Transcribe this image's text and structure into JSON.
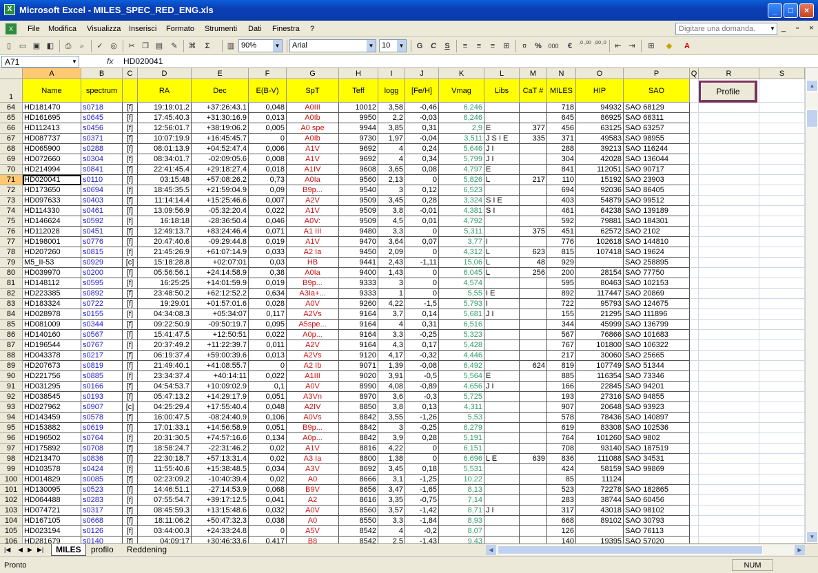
{
  "window": {
    "title": "Microsoft Excel - MILES_SPEC_RED_ENG.xls",
    "app_icon": "excel-icon"
  },
  "menu": {
    "items": [
      "File",
      "Modifica",
      "Visualizza",
      "Inserisci",
      "Formato",
      "Strumenti",
      "Dati",
      "Finestra",
      "?"
    ],
    "ask_placeholder": "Digitare una domanda."
  },
  "toolbar": {
    "zoom": "90%",
    "font": "Arial",
    "size": "10",
    "bold": "G",
    "italic": "C",
    "underline": "S",
    "sum": "Σ",
    "percent": "%",
    "thousands": "000",
    "euro": "€",
    "dec_inc": ",0 ,00",
    "dec_dec": ",00 ,0"
  },
  "formula": {
    "name_box": "A71",
    "fx": "fx",
    "content": "HD020041"
  },
  "columns": [
    "A",
    "B",
    "C",
    "D",
    "E",
    "F",
    "G",
    "H",
    "I",
    "J",
    "K",
    "L",
    "M",
    "N",
    "O",
    "P",
    "Q",
    "R",
    "S"
  ],
  "header_row_number": "1",
  "headers": [
    "Name",
    "spectrum",
    "",
    "RA",
    "Dec",
    "E(B-V)",
    "SpT",
    "Teff",
    "logg",
    "[Fe/H]",
    "Vmag",
    "Libs",
    "CaT #",
    "MILES",
    "HIP",
    "SAO"
  ],
  "profile_button": "Profile",
  "rows": [
    [
      "64",
      "HD181470",
      "s0718",
      "[f]",
      "19:19:01.2",
      "+37:26:43.1",
      "0,048",
      "A0III",
      "10012",
      "3,58",
      "-0,46",
      "6,246",
      "",
      "",
      "718",
      "94932",
      "SAO 68129"
    ],
    [
      "65",
      "HD161695",
      "s0645",
      "[f]",
      "17:45:40.3",
      "+31:30:16.9",
      "0,013",
      "A0Ib",
      "9950",
      "2,2",
      "-0,03",
      "6,246",
      "",
      "",
      "645",
      "86925",
      "SAO 66311"
    ],
    [
      "66",
      "HD112413",
      "s0456",
      "[f]",
      "12:56:01.7",
      "+38:19:06.2",
      "0,005",
      "A0 spe",
      "9944",
      "3,85",
      "0,31",
      "2,9",
      "E",
      "377",
      "456",
      "63125",
      "SAO 63257"
    ],
    [
      "67",
      "HD087737",
      "s0371",
      "[f]",
      "10:07:19.9",
      "+16:45:45.7",
      "0",
      "A0Ib",
      "9730",
      "1,97",
      "-0,04",
      "3,511",
      "J S I E",
      "335",
      "371",
      "49583",
      "SAO 98955"
    ],
    [
      "68",
      "HD065900",
      "s0288",
      "[f]",
      "08:01:13.9",
      "+04:52:47.4",
      "0,006",
      "A1V",
      "9692",
      "4",
      "0,24",
      "5,646",
      "J I",
      "",
      "288",
      "39213",
      "SAO 116244"
    ],
    [
      "69",
      "HD072660",
      "s0304",
      "[f]",
      "08:34:01.7",
      "-02:09:05.6",
      "0,008",
      "A1V",
      "9692",
      "4",
      "0,34",
      "5,799",
      "J I",
      "",
      "304",
      "42028",
      "SAO 136044"
    ],
    [
      "70",
      "HD214994",
      "s0841",
      "[f]",
      "22:41:45.4",
      "+29:18:27.4",
      "0,018",
      "A1IV",
      "9608",
      "3,65",
      "0,08",
      "4,797",
      "E",
      "",
      "841",
      "112051",
      "SAO 90717"
    ],
    [
      "71",
      "HD020041",
      "s0110",
      "[f]",
      "03:15:48",
      "+57:08:26.2",
      "0,73",
      "A0Ia",
      "9560",
      "2,13",
      "0",
      "5,826",
      "L",
      "217",
      "110",
      "15192",
      "SAO 23903"
    ],
    [
      "72",
      "HD173650",
      "s0694",
      "[f]",
      "18:45:35.5",
      "+21:59:04.9",
      "0,09",
      "B9p...",
      "9540",
      "3",
      "0,12",
      "6,523",
      "",
      "",
      "694",
      "92036",
      "SAO 86405"
    ],
    [
      "73",
      "HD097633",
      "s0403",
      "[f]",
      "11:14:14.4",
      "+15:25:46.6",
      "0,007",
      "A2V",
      "9509",
      "3,45",
      "0,28",
      "3,324",
      "S I E",
      "",
      "403",
      "54879",
      "SAO 99512"
    ],
    [
      "74",
      "HD114330",
      "s0461",
      "[f]",
      "13:09:56.9",
      "-05:32:20.4",
      "0,022",
      "A1V",
      "9509",
      "3,8",
      "-0,01",
      "4,381",
      "S I",
      "",
      "461",
      "64238",
      "SAO 139189"
    ],
    [
      "75",
      "HD146624",
      "s0592",
      "[f]",
      "16:18:18",
      "-28:36:50.4",
      "0,046",
      "A0V:",
      "9509",
      "4,5",
      "0,01",
      "4,792",
      "",
      "",
      "592",
      "79881",
      "SAO 184301"
    ],
    [
      "76",
      "HD112028",
      "s0451",
      "[f]",
      "12:49:13.7",
      "+83:24:46.4",
      "0,071",
      "A1 III",
      "9480",
      "3,3",
      "0",
      "5,311",
      "",
      "375",
      "451",
      "62572",
      "SAO 2102"
    ],
    [
      "77",
      "HD198001",
      "s0776",
      "[f]",
      "20:47:40.6",
      "-09:29:44.8",
      "0,019",
      "A1V",
      "9470",
      "3,64",
      "0,07",
      "3,77",
      "I",
      "",
      "776",
      "102618",
      "SAO 144810"
    ],
    [
      "78",
      "HD207260",
      "s0815",
      "[f]",
      "21:45:26.9",
      "+61:07:14.9",
      "0,033",
      "A2 Ia",
      "9450",
      "2,09",
      "0",
      "4,312",
      "L",
      "623",
      "815",
      "107418",
      "SAO 19624"
    ],
    [
      "79",
      "M5_II-53",
      "s0929",
      "[c]",
      "15:18:28.8",
      "+02:07:01",
      "0,03",
      "HB",
      "9441",
      "2,43",
      "-1,11",
      "15,06",
      "L",
      "48",
      "929",
      "",
      "SAO 258895"
    ],
    [
      "80",
      "HD039970",
      "s0200",
      "[f]",
      "05:56:56.1",
      "+24:14:58.9",
      "0,38",
      "A0Ia",
      "9400",
      "1,43",
      "0",
      "6,045",
      "L",
      "256",
      "200",
      "28154",
      "SAO 77750"
    ],
    [
      "81",
      "HD148112",
      "s0595",
      "[f]",
      "16:25:25",
      "+14:01:59.9",
      "0,019",
      "B9p...",
      "9333",
      "3",
      "0",
      "4,574",
      "",
      "",
      "595",
      "80463",
      "SAO 102153"
    ],
    [
      "82",
      "HD223385",
      "s0892",
      "[f]",
      "23:48:50.2",
      "+62:12:52.2",
      "0,634",
      "A3Ia+...",
      "9333",
      "1",
      "0",
      "5,55",
      "I E",
      "",
      "892",
      "117447",
      "SAO 20869"
    ],
    [
      "83",
      "HD183324",
      "s0722",
      "[f]",
      "19:29:01",
      "+01:57:01.6",
      "0,028",
      "A0V",
      "9260",
      "4,22",
      "-1,5",
      "5,793",
      "I",
      "",
      "722",
      "95793",
      "SAO 124675"
    ],
    [
      "84",
      "HD028978",
      "s0155",
      "[f]",
      "04:34:08.3",
      "+05:34:07",
      "0,117",
      "A2Vs",
      "9164",
      "3,7",
      "0,14",
      "5,681",
      "J I",
      "",
      "155",
      "21295",
      "SAO 111896"
    ],
    [
      "85",
      "HD081009",
      "s0344",
      "[f]",
      "09:22:50.9",
      "-09:50:19.7",
      "0,095",
      "A5spe...",
      "9164",
      "4",
      "0,31",
      "6,516",
      "",
      "",
      "344",
      "45999",
      "SAO 136799"
    ],
    [
      "86",
      "HD140160",
      "s0567",
      "[f]",
      "15:41:47.5",
      "+12:50:51",
      "0,022",
      "A0p...",
      "9164",
      "3,3",
      "-0,25",
      "5,323",
      "",
      "",
      "567",
      "76866",
      "SAO 101683"
    ],
    [
      "87",
      "HD196544",
      "s0767",
      "[f]",
      "20:37:49.2",
      "+11:22:39.7",
      "0,011",
      "A2V",
      "9164",
      "4,3",
      "0,17",
      "5,428",
      "",
      "",
      "767",
      "101800",
      "SAO 106322"
    ],
    [
      "88",
      "HD043378",
      "s0217",
      "[f]",
      "06:19:37.4",
      "+59:00:39.6",
      "0,013",
      "A2Vs",
      "9120",
      "4,17",
      "-0,32",
      "4,446",
      "",
      "",
      "217",
      "30060",
      "SAO 25665"
    ],
    [
      "89",
      "HD207673",
      "s0819",
      "[f]",
      "21:49:40.1",
      "+41:08:55.7",
      "0",
      "A2 Ib",
      "9071",
      "1,39",
      "-0,08",
      "6,492",
      "",
      "624",
      "819",
      "107749",
      "SAO 51344"
    ],
    [
      "90",
      "HD221756",
      "s0885",
      "[f]",
      "23:34:37.4",
      "+40:14:11",
      "0,022",
      "A1III",
      "9020",
      "3,91",
      "-0,5",
      "5,564",
      "E",
      "",
      "885",
      "116354",
      "SAO 73346"
    ],
    [
      "91",
      "HD031295",
      "s0166",
      "[f]",
      "04:54:53.7",
      "+10:09:02.9",
      "0,1",
      "A0V",
      "8990",
      "4,08",
      "-0,89",
      "4,656",
      "J I",
      "",
      "166",
      "22845",
      "SAO 94201"
    ],
    [
      "92",
      "HD038545",
      "s0193",
      "[f]",
      "05:47:13.2",
      "+14:29:17.9",
      "0,051",
      "A3Vn",
      "8970",
      "3,6",
      "-0,3",
      "5,725",
      "",
      "",
      "193",
      "27316",
      "SAO 94855"
    ],
    [
      "93",
      "HD027962",
      "s0907",
      "[c]",
      "04:25:29.4",
      "+17:55:40.4",
      "0,048",
      "A2IV",
      "8850",
      "3,8",
      "0,13",
      "4,311",
      "",
      "",
      "907",
      "20648",
      "SAO 93923"
    ],
    [
      "94",
      "HD143459",
      "s0578",
      "[f]",
      "16:00:47.5",
      "-08:24:40.9",
      "0,106",
      "A0Vs",
      "8842",
      "3,55",
      "-1,26",
      "5,53",
      "",
      "",
      "578",
      "78436",
      "SAO 140897"
    ],
    [
      "95",
      "HD153882",
      "s0619",
      "[f]",
      "17:01:33.1",
      "+14:56:58.9",
      "0,051",
      "B9p...",
      "8842",
      "3",
      "-0,25",
      "6,279",
      "",
      "",
      "619",
      "83308",
      "SAO 102536"
    ],
    [
      "96",
      "HD196502",
      "s0764",
      "[f]",
      "20:31:30.5",
      "+74:57:16.6",
      "0,134",
      "A0p...",
      "8842",
      "3,9",
      "0,28",
      "5,191",
      "",
      "",
      "764",
      "101260",
      "SAO 9802"
    ],
    [
      "97",
      "HD175892",
      "s0708",
      "[f]",
      "18:58:24.7",
      "-22:31:46.2",
      "0,02",
      "A1V",
      "8816",
      "4,22",
      "0",
      "6,151",
      "",
      "",
      "708",
      "93140",
      "SAO 187519"
    ],
    [
      "98",
      "HD213470",
      "s0836",
      "[f]",
      "22:30:18.7",
      "+57:13:31.4",
      "0,02",
      "A3 Ia",
      "8800",
      "1,38",
      "0",
      "6,696",
      "L E",
      "639",
      "836",
      "111088",
      "SAO 34531"
    ],
    [
      "99",
      "HD103578",
      "s0424",
      "[f]",
      "11:55:40.6",
      "+15:38:48.5",
      "0,034",
      "A3V",
      "8692",
      "3,45",
      "0,18",
      "5,531",
      "",
      "",
      "424",
      "58159",
      "SAO 99869"
    ],
    [
      "100",
      "HD014829",
      "s0085",
      "[f]",
      "02:23:09.2",
      "-10:40:39.4",
      "0,02",
      "A0",
      "8666",
      "3,1",
      "-1,25",
      "10,22",
      "",
      "",
      "85",
      "11124",
      ""
    ],
    [
      "101",
      "HD130095",
      "s0523",
      "[f]",
      "14:46:51.1",
      "-27:14:53.9",
      "0,068",
      "B9V",
      "8656",
      "3,47",
      "-1,65",
      "8,13",
      "",
      "",
      "523",
      "72278",
      "SAO 182865"
    ],
    [
      "102",
      "HD064488",
      "s0283",
      "[f]",
      "07:55:54.7",
      "+39:17:12.5",
      "0,041",
      "A2",
      "8616",
      "3,35",
      "-0,75",
      "7,14",
      "",
      "",
      "283",
      "38744",
      "SAO 60456"
    ],
    [
      "103",
      "HD074721",
      "s0317",
      "[f]",
      "08:45:59.3",
      "+13:15:48.6",
      "0,032",
      "A0V",
      "8560",
      "3,57",
      "-1,42",
      "8,71",
      "J I",
      "",
      "317",
      "43018",
      "SAO 98102"
    ],
    [
      "104",
      "HD167105",
      "s0668",
      "[f]",
      "18:11:06.2",
      "+50:47:32.3",
      "0,038",
      "A0",
      "8550",
      "3,3",
      "-1,84",
      "8,93",
      "",
      "",
      "668",
      "89102",
      "SAO 30793"
    ],
    [
      "105",
      "HD023194",
      "s0126",
      "[f]",
      "03:44:00.3",
      "+24:33:24.8",
      "0",
      "A5V",
      "8542",
      "4",
      "-0,2",
      "8,07",
      "",
      "",
      "126",
      "",
      "SAO 76113"
    ],
    [
      "106",
      "HD281679",
      "s0140",
      "[f]",
      "04:09:17",
      "+30:46:33.6",
      "0,417",
      "B8",
      "8542",
      "2,5",
      "-1,43",
      "9,43",
      "",
      "",
      "140",
      "19395",
      "SAO 57020"
    ]
  ],
  "sheets": [
    "MILES",
    "profilo",
    "Reddening"
  ],
  "status": {
    "left": "Pronto",
    "num": "NUM"
  },
  "colors": {
    "header_fill": "#ffff00",
    "spectrum": "#1a1acc",
    "spt": "#cc1111",
    "vmag": "#2e9a6a",
    "profile_border": "#7b2f58"
  }
}
